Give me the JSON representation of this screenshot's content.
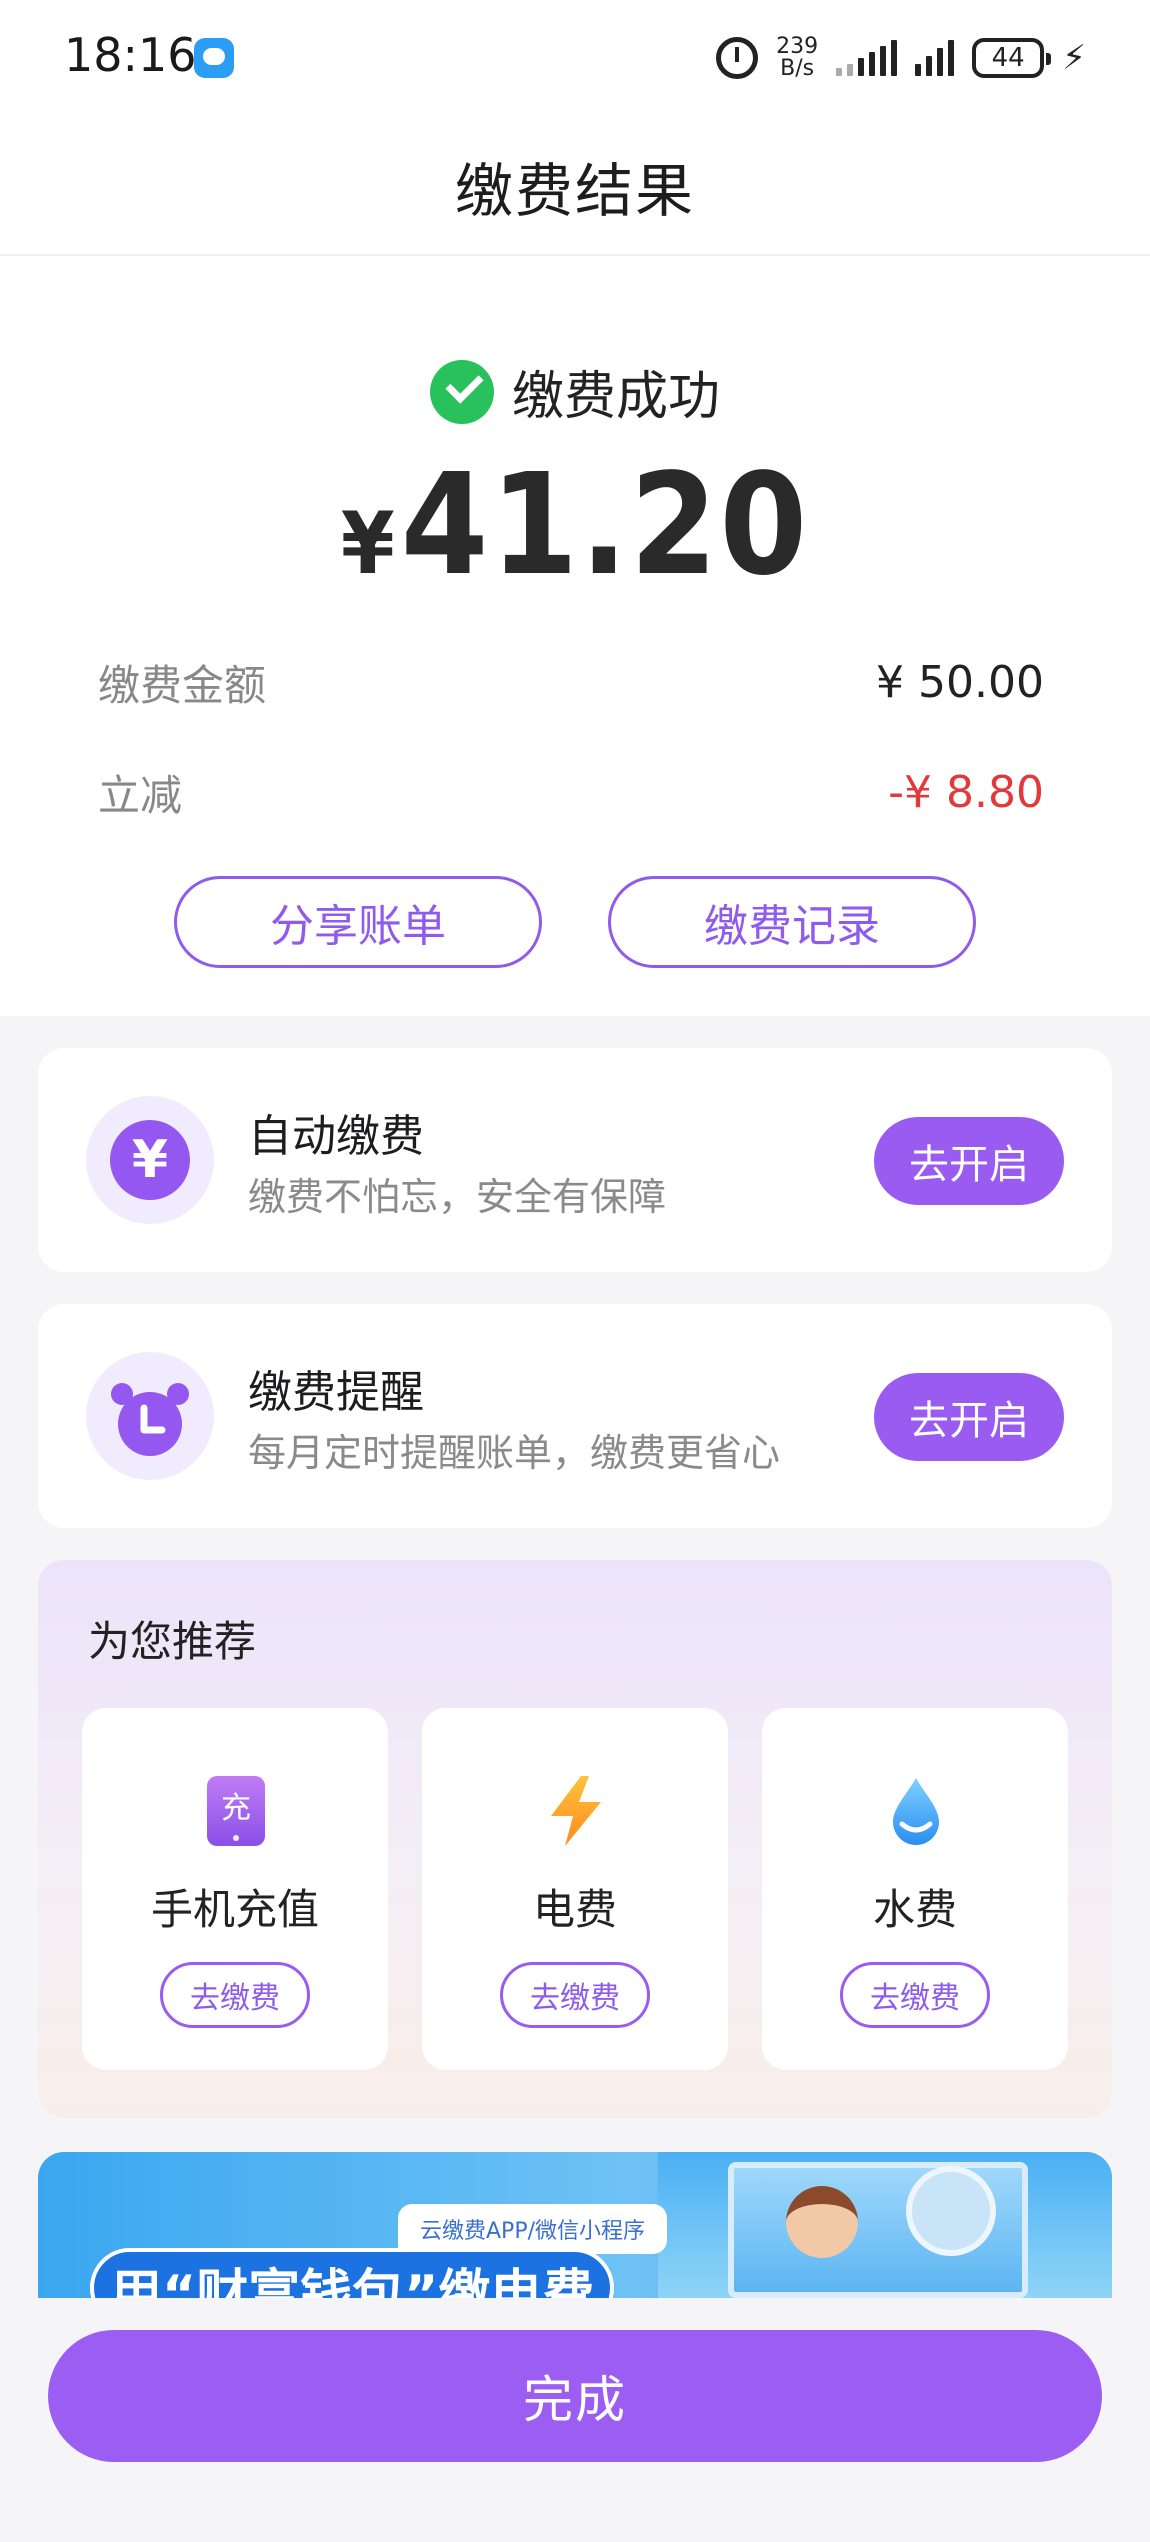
{
  "status_bar": {
    "time": "18:16",
    "net_speed_value": "239",
    "net_speed_unit": "B/s",
    "battery": "44",
    "icons": [
      "chat-notification-icon",
      "alarm-icon",
      "signal-icon",
      "battery-icon",
      "charging-icon"
    ]
  },
  "header": {
    "title": "缴费结果"
  },
  "result": {
    "status": "缴费成功",
    "currency": "¥",
    "amount": "41.20",
    "rows": [
      {
        "label": "缴费金额",
        "value": "¥ 50.00"
      },
      {
        "label": "立减",
        "value": "-¥ 8.80"
      }
    ],
    "share_button": "分享账单",
    "records_button": "缴费记录"
  },
  "features": [
    {
      "icon": "yen-coin-icon",
      "title": "自动缴费",
      "subtitle": "缴费不怕忘，安全有保障",
      "button": "去开启"
    },
    {
      "icon": "alarm-clock-icon",
      "title": "缴费提醒",
      "subtitle": "每月定时提醒账单，缴费更省心",
      "button": "去开启"
    }
  ],
  "recommend": {
    "title": "为您推荐",
    "items": [
      {
        "icon": "phone-recharge-icon",
        "icon_char": "充",
        "name": "手机充值",
        "button": "去缴费"
      },
      {
        "icon": "lightning-icon",
        "name": "电费",
        "button": "去缴费"
      },
      {
        "icon": "water-drop-icon",
        "name": "水费",
        "button": "去缴费"
      }
    ]
  },
  "banner": {
    "tag": "云缴费APP/微信小程序",
    "headline": "用“财富钱包”缴电费"
  },
  "done_button": "完成",
  "colors": {
    "accent": "#9a5cf0",
    "success": "#28c15b",
    "discount": "#e23a3a"
  }
}
